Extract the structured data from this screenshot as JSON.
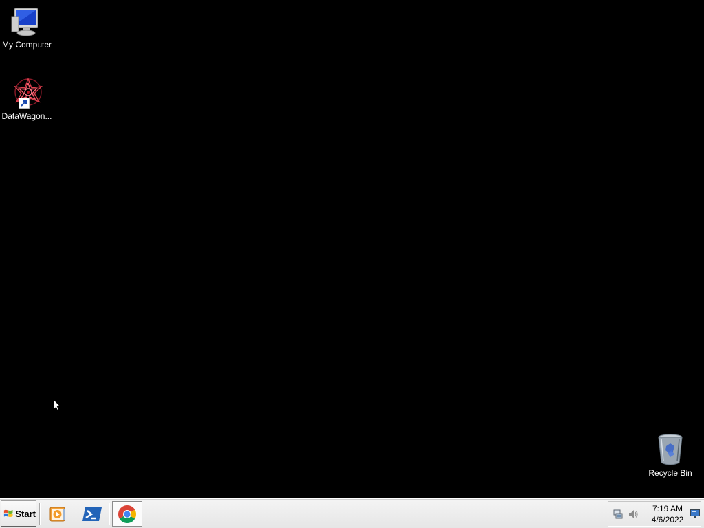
{
  "desktop": {
    "icons": [
      {
        "label": "My Computer",
        "icon": "computer-icon"
      },
      {
        "label": "DataWagon...",
        "icon": "datawagon-icon"
      },
      {
        "label": "Recycle Bin",
        "icon": "recycle-bin-icon"
      }
    ],
    "background_color": "#000000"
  },
  "taskbar": {
    "start_label": "Start",
    "pinned": [
      {
        "icon": "media-player-icon"
      },
      {
        "icon": "powershell-icon"
      },
      {
        "icon": "chrome-icon",
        "active": true
      }
    ],
    "tray": {
      "icons": [
        "network-icon",
        "volume-icon"
      ],
      "time": "7:19 AM",
      "date": "4/6/2022"
    }
  }
}
